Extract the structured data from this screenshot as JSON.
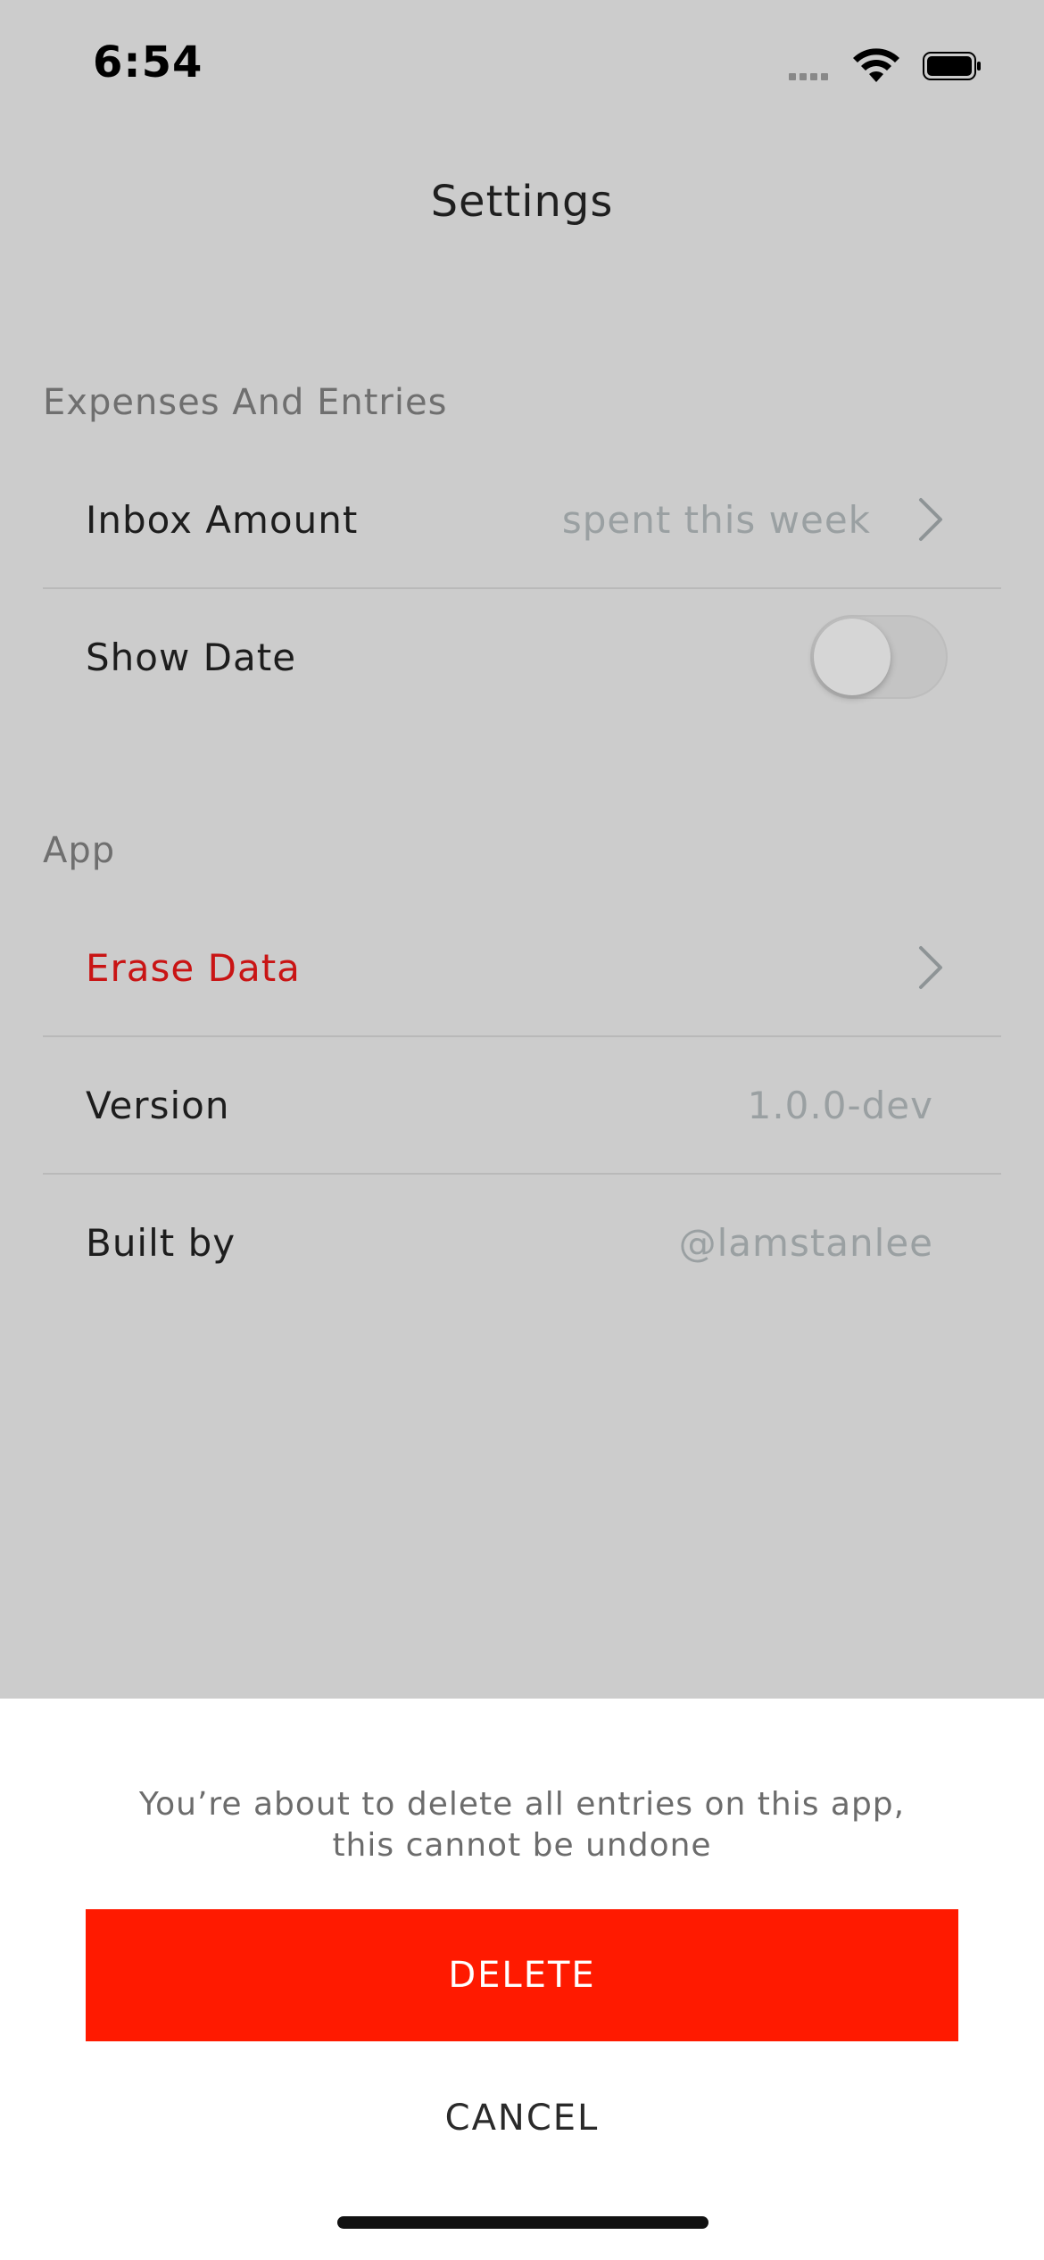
{
  "status_bar": {
    "time": "6:54"
  },
  "nav": {
    "title": "Settings"
  },
  "sections": {
    "expenses": {
      "header": "Expenses And Entries",
      "inbox_amount": {
        "label": "Inbox Amount",
        "value": "spent this week"
      },
      "show_date": {
        "label": "Show Date",
        "toggle_on": false
      }
    },
    "app": {
      "header": "App",
      "erase_data": {
        "label": "Erase Data"
      },
      "version": {
        "label": "Version",
        "value": "1.0.0-dev"
      },
      "built_by": {
        "label": "Built by",
        "value": "@lamstanlee"
      }
    }
  },
  "sheet": {
    "message": "You’re about to delete all entries on this app, this cannot be undone",
    "delete_label": "DELETE",
    "cancel_label": "CANCEL"
  },
  "colors": {
    "background": "#cccccc",
    "danger_text": "#c91414",
    "delete_button": "#ff1a00",
    "value_text": "#9aa0a2"
  },
  "icons": [
    "signal-icon",
    "wifi-icon",
    "battery-icon",
    "chevron-right-icon"
  ]
}
